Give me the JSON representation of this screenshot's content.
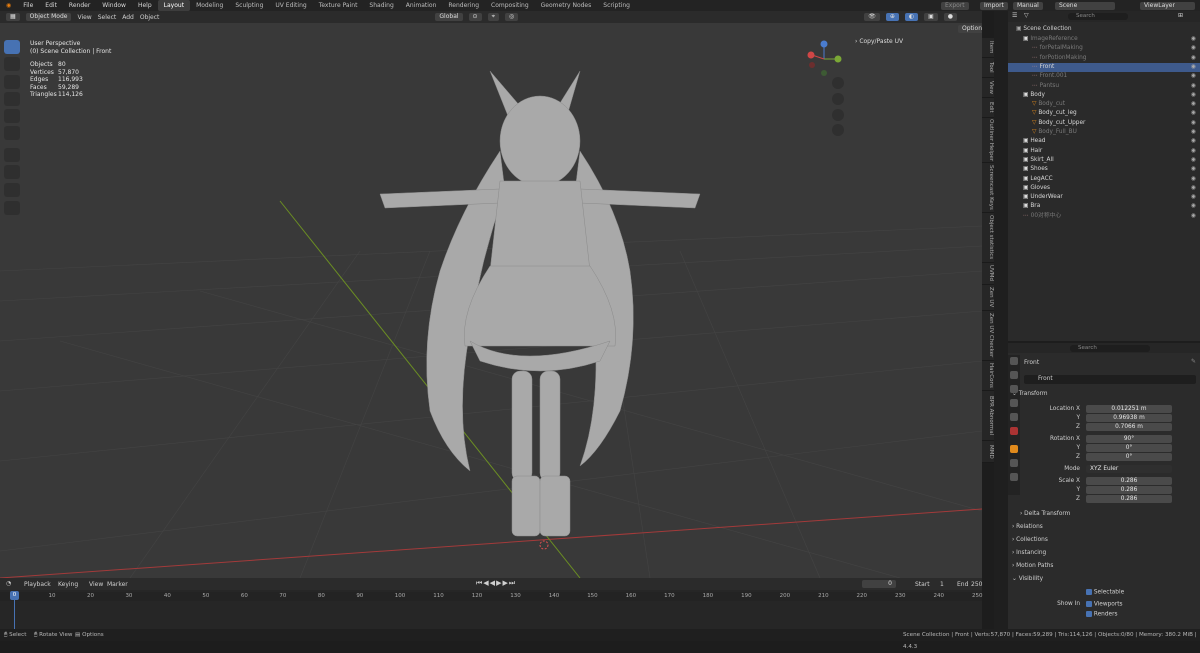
{
  "menu": [
    "File",
    "Edit",
    "Render",
    "Window",
    "Help"
  ],
  "workspaces": [
    "Layout",
    "Modeling",
    "Sculpting",
    "UV Editing",
    "Texture Paint",
    "Shading",
    "Animation",
    "Rendering",
    "Compositing",
    "Geometry Nodes",
    "Scripting"
  ],
  "topright": {
    "export": "Export",
    "import": "Import",
    "manual": "Manual",
    "scene": "Scene",
    "viewlayer": "ViewLayer"
  },
  "viewport": {
    "mode": "Object Mode",
    "view": "View",
    "select": "Select",
    "add": "Add",
    "object": "Object",
    "orientation": "Global",
    "options": "Options",
    "overlay_title": "User Perspective",
    "overlay_sub": "(0) Scene Collection | Front",
    "stats": [
      [
        "Objects",
        "80"
      ],
      [
        "Vertices",
        "57,870"
      ],
      [
        "Edges",
        "116,993"
      ],
      [
        "Faces",
        "59,289"
      ],
      [
        "Triangles",
        "114,126"
      ]
    ],
    "copy_paste": "Copy/Paste UV"
  },
  "sidetabs": [
    "Item",
    "Tool",
    "View",
    "Edit",
    "Outliner Helper",
    "Screencast Keys",
    "Object statistics",
    "UVMd",
    "Zen UV",
    "Zen UV Checker",
    "HairCons",
    "BPR Abnormal",
    "MMD"
  ],
  "outliner": {
    "search": "Search",
    "root": "Scene Collection",
    "rows": [
      {
        "label": "ImageReference",
        "indent": 1,
        "kind": "collection",
        "dim": true
      },
      {
        "label": "forPetalMaking",
        "indent": 2,
        "kind": "empty",
        "dim": true
      },
      {
        "label": "forPotionMaking",
        "indent": 2,
        "kind": "empty",
        "dim": true
      },
      {
        "label": "Front",
        "indent": 2,
        "kind": "empty",
        "dim": false,
        "selected": true
      },
      {
        "label": "Front.001",
        "indent": 2,
        "kind": "empty",
        "dim": true
      },
      {
        "label": "Pantsu",
        "indent": 2,
        "kind": "empty",
        "dim": true
      },
      {
        "label": "Body",
        "indent": 1,
        "kind": "collection",
        "dim": false
      },
      {
        "label": "Body_cut",
        "indent": 2,
        "kind": "mesh",
        "dim": true
      },
      {
        "label": "Body_cut_leg",
        "indent": 2,
        "kind": "mesh",
        "dim": false
      },
      {
        "label": "Body_cut_Upper",
        "indent": 2,
        "kind": "mesh",
        "dim": false
      },
      {
        "label": "Body_Full_BU",
        "indent": 2,
        "kind": "mesh",
        "dim": true
      },
      {
        "label": "Head",
        "indent": 1,
        "kind": "collection",
        "dim": false
      },
      {
        "label": "Hair",
        "indent": 1,
        "kind": "collection",
        "dim": false
      },
      {
        "label": "Skirt_All",
        "indent": 1,
        "kind": "collection",
        "dim": false
      },
      {
        "label": "Shoes",
        "indent": 1,
        "kind": "collection",
        "dim": false
      },
      {
        "label": "LegACC",
        "indent": 1,
        "kind": "collection",
        "dim": false
      },
      {
        "label": "Gloves",
        "indent": 1,
        "kind": "collection",
        "dim": false
      },
      {
        "label": "UnderWear",
        "indent": 1,
        "kind": "collection",
        "dim": false
      },
      {
        "label": "Bra",
        "indent": 1,
        "kind": "collection",
        "dim": false
      },
      {
        "label": "00对称中心",
        "indent": 1,
        "kind": "empty",
        "dim": true
      }
    ]
  },
  "properties": {
    "search": "Search",
    "object_name": "Front",
    "name_field": "Front",
    "transform": "Transform",
    "location_label": "Location X",
    "loc": [
      "0.012251 m",
      "0.96938 m",
      "0.7066 m"
    ],
    "rotation_label": "Rotation X",
    "rot": [
      "90°",
      "0°",
      "0°"
    ],
    "mode_label": "Mode",
    "mode": "XYZ Euler",
    "scale_label": "Scale X",
    "scale": [
      "0.286",
      "0.286",
      "0.286"
    ],
    "y": "Y",
    "z": "Z",
    "sections": [
      "Delta Transform",
      "Relations",
      "Collections",
      "Instancing",
      "Motion Paths"
    ],
    "visibility": "Visibility",
    "selectable": "Selectable",
    "show_in": "Show In",
    "viewports": "Viewports",
    "renders": "Renders"
  },
  "timeline": {
    "playback": "Playback",
    "keying": "Keying",
    "view": "View",
    "marker": "Marker",
    "frame": "0",
    "start_label": "Start",
    "start": "1",
    "end_label": "End",
    "end": "250",
    "ticks": [
      "0",
      "10",
      "20",
      "30",
      "40",
      "50",
      "60",
      "70",
      "80",
      "90",
      "100",
      "110",
      "120",
      "130",
      "140",
      "150",
      "160",
      "170",
      "180",
      "190",
      "200",
      "210",
      "220",
      "230",
      "240",
      "250"
    ],
    "current": "0"
  },
  "status": {
    "select": "Select",
    "rotate": "Rotate View",
    "options": "Options",
    "right": "Scene Collection | Front | Verts:57,870 | Faces:59,289 | Tris:114,126 | Objects:0/80 | Memory: 380.2 MiB | 4.4.3"
  },
  "colors": {
    "accent": "#4772b3",
    "selected_row": "#3e5a8c",
    "grid_x": "#a33a3a",
    "grid_y": "#6b8e23"
  }
}
